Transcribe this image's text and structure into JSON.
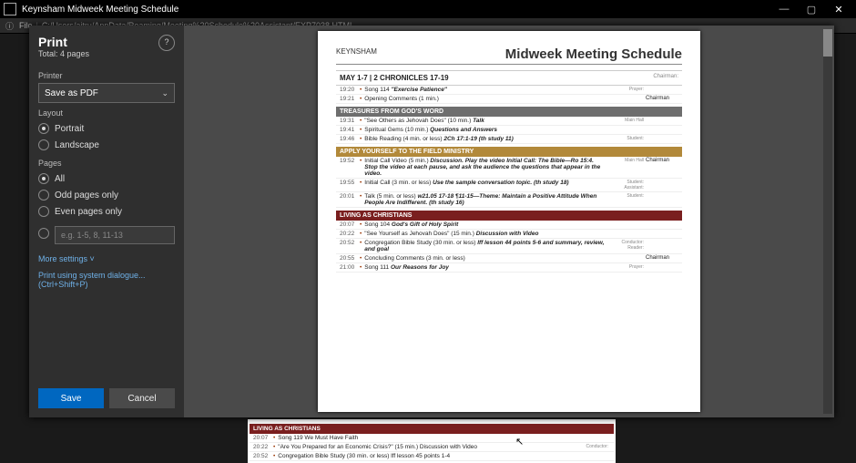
{
  "window": {
    "title": "Keynsham Midweek Meeting Schedule"
  },
  "address": {
    "prefix": "File",
    "path": "C:/Users/ajtru/AppData/Roaming/Meeting%20Schedule%20Assistant/EXP7038.HTML"
  },
  "print": {
    "title": "Print",
    "total": "Total: 4 pages",
    "printer_label": "Printer",
    "printer_value": "Save as PDF",
    "layout_label": "Layout",
    "portrait": "Portrait",
    "landscape": "Landscape",
    "pages_label": "Pages",
    "all": "All",
    "odd": "Odd pages only",
    "even": "Even pages only",
    "custom_ph": "e.g. 1-5, 8, 11-13",
    "more": "More settings ˅",
    "systemdlg": "Print using system dialogue... (Ctrl+Shift+P)",
    "save": "Save",
    "cancel": "Cancel"
  },
  "sched": {
    "cong": "KEYNSHAM",
    "title": "Midweek Meeting Schedule",
    "week": "MAY 1-7 | 2 CHRONICLES 17-19",
    "chairman_lbl": "Chairman:",
    "sec_treasures": "TREASURES FROM GOD'S WORD",
    "sec_apply": "APPLY YOURSELF TO THE FIELD MINISTRY",
    "sec_living": "LIVING AS CHRISTIANS",
    "rows1": [
      {
        "t": "19:20",
        "txt": "Song 114 ",
        "em": "\"Exercise Patience\"",
        "role": "Prayer:",
        "name": ""
      },
      {
        "t": "19:21",
        "txt": "Opening Comments  (1 min.)",
        "role": "",
        "name": "Chairman"
      }
    ],
    "rows2": [
      {
        "t": "19:31",
        "txt": "\"See Others as Jehovah Does\"  (10 min.) ",
        "em": "Talk",
        "role": "Main Hall",
        "name": ""
      },
      {
        "t": "19:41",
        "txt": "Spiritual Gems  (10 min.) ",
        "em": "Questions and Answers",
        "role": "",
        "name": ""
      },
      {
        "t": "19:46",
        "txt": "Bible Reading  (4 min. or less) ",
        "em": "2Ch 17:1-19 (th study 11)",
        "role": "Student:",
        "name": ""
      }
    ],
    "rows3": [
      {
        "t": "19:52",
        "txt": "Initial Call Video  (5 min.) ",
        "em": "Discussion. Play the video Initial Call: The Bible—Ro 15:4. Stop the video at each pause, and ask the audience the questions that appear in the video.",
        "role": "Main Hall",
        "name": "Chairman"
      },
      {
        "t": "19:55",
        "txt": "Initial Call  (3 min. or less) ",
        "em": "Use the sample conversation topic. (th study 18)",
        "role": "Student: Assistant:",
        "name": ""
      },
      {
        "t": "20:01",
        "txt": "Talk  (5 min. or less) ",
        "em": "w21.05 17-18 ¶11-15—Theme: Maintain a Positive Attitude When People Are Indifferent. (th study 16)",
        "role": "Student:",
        "name": ""
      }
    ],
    "rows4": [
      {
        "t": "20:07",
        "txt": "Song 104 ",
        "em": "God's Gift of Holy Spirit",
        "role": "",
        "name": ""
      },
      {
        "t": "20:22",
        "txt": "\"See Yourself as Jehovah Does\"  (15 min.) ",
        "em": "Discussion with Video",
        "role": "",
        "name": ""
      },
      {
        "t": "20:52",
        "txt": "Congregation Bible Study  (30 min. or less) ",
        "em": "lff lesson 44 points 5-6 and summary, review, and goal",
        "role": "Conductor: Reader:",
        "name": ""
      },
      {
        "t": "20:55",
        "txt": "Concluding Comments  (3 min. or less)",
        "role": "",
        "name": "Chairman"
      },
      {
        "t": "21:00",
        "txt": "Song 111 ",
        "em": "Our Reasons for Joy",
        "role": "Prayer:",
        "name": ""
      }
    ]
  },
  "bg": {
    "sec": "LIVING AS CHRISTIANS",
    "r1_t": "20:07",
    "r1": "Song 119 We Must Have Faith",
    "r2_t": "20:22",
    "r2": "\"Are You Prepared for an Economic Crisis?\"  (15 min.) Discussion with Video",
    "r3_t": "20:52",
    "r3": "Congregation Bible Study  (30 min. or less) lff lesson 45 points 1-4",
    "conductor": "Conductor:"
  }
}
